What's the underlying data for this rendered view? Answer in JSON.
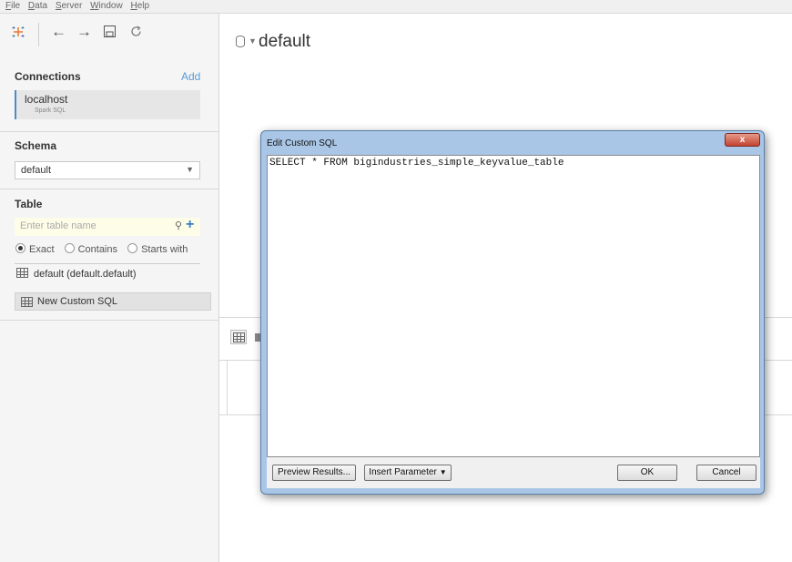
{
  "menu": [
    "File",
    "Data",
    "Server",
    "Window",
    "Help"
  ],
  "toolbar": {
    "back": "←",
    "forward": "→",
    "save": "💾",
    "refresh": "⟳"
  },
  "connections": {
    "title": "Connections",
    "add_label": "Add",
    "items": [
      {
        "name": "localhost",
        "type": "Spark SQL"
      }
    ]
  },
  "schema": {
    "title": "Schema",
    "selected": "default"
  },
  "table": {
    "title": "Table",
    "search_placeholder": "Enter table name",
    "match_options": [
      "Exact",
      "Contains",
      "Starts with"
    ],
    "selected_option": "Exact",
    "items": [
      "default (default.default)"
    ],
    "custom_sql_label": "New Custom SQL"
  },
  "main": {
    "datasource_title": "default"
  },
  "dialog": {
    "title": "Edit Custom SQL",
    "close_label": "x",
    "sql": "SELECT * FROM bigindustries_simple_keyvalue_table",
    "preview_label": "Preview Results...",
    "insert_param_label": "Insert Parameter",
    "ok_label": "OK",
    "cancel_label": "Cancel"
  },
  "colors": {
    "accent": "#4a8bc8",
    "add_link": "#5b9bd5",
    "dialog_frame": "#a9c6e6",
    "close_button": "#c44331"
  }
}
